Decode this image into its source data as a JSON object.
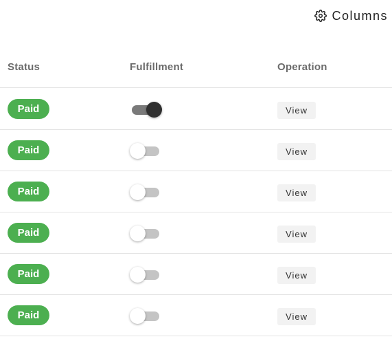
{
  "toolbar": {
    "columns_label": "Columns",
    "columns_icon": "gear-icon"
  },
  "table": {
    "headers": {
      "status": "Status",
      "fulfillment": "Fulfillment",
      "operation": "Operation"
    },
    "rows": [
      {
        "status": "Paid",
        "fulfilled": true,
        "operation": "View"
      },
      {
        "status": "Paid",
        "fulfilled": false,
        "operation": "View"
      },
      {
        "status": "Paid",
        "fulfilled": false,
        "operation": "View"
      },
      {
        "status": "Paid",
        "fulfilled": false,
        "operation": "View"
      },
      {
        "status": "Paid",
        "fulfilled": false,
        "operation": "View"
      },
      {
        "status": "Paid",
        "fulfilled": false,
        "operation": "View"
      }
    ]
  },
  "colors": {
    "status_paid": "#4caf50",
    "toggle_on_knob": "#2f2f2f",
    "toggle_off_track": "#c4c4c4",
    "view_button_bg": "#f2f2f2"
  }
}
